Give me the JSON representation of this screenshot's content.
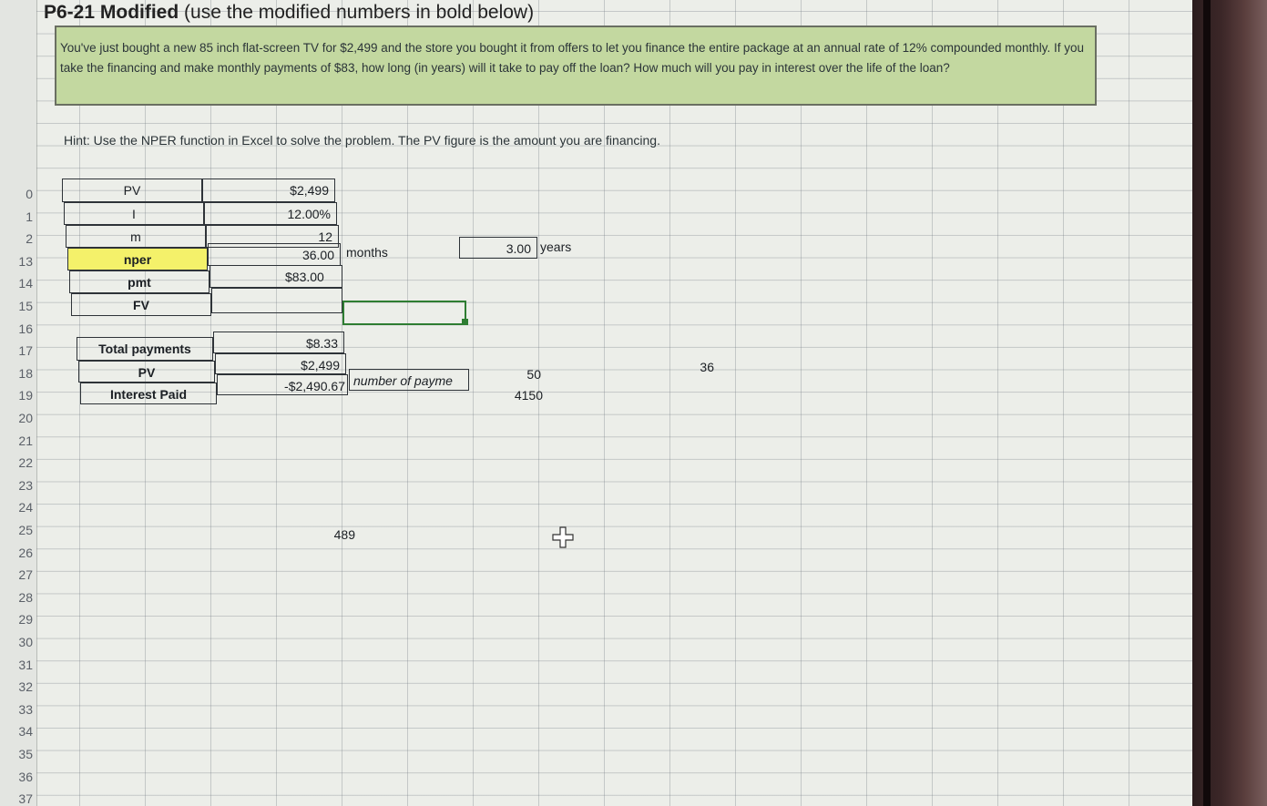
{
  "title": {
    "main": "P6-21 Modified",
    "sub": "(use the modified numbers in bold below)"
  },
  "problem_text": "You've just bought a new 85 inch flat-screen TV for $2,499 and the store you bought it from offers to let you finance the entire package at an annual rate of 12% compounded monthly. If you take the financing and make monthly payments of $83, how long (in years) will it take to pay off the loan? How much will you pay in interest over the life of the loan?",
  "hint": "Hint:  Use the NPER function in Excel to solve the problem.  The PV figure is the amount you are financing.",
  "row_numbers": [
    "0",
    "1",
    "2",
    "13",
    "14",
    "15",
    "16",
    "17",
    "18",
    "19",
    "20",
    "21",
    "22",
    "23",
    "24",
    "25",
    "26",
    "27",
    "28",
    "29",
    "30",
    "31",
    "32",
    "33",
    "34",
    "35",
    "36",
    "37"
  ],
  "inputs": {
    "pv_label": "PV",
    "pv_value": "$2,499",
    "i_label": "I",
    "i_value": "12.00%",
    "m_label": "m",
    "m_value": "12",
    "nper_label": "nper",
    "nper_value": "36.00",
    "nper_unit": "months",
    "pmt_label": "pmt",
    "pmt_value": "$83.00",
    "fv_label": "FV"
  },
  "years": {
    "value": "3.00",
    "unit": "years"
  },
  "summary": {
    "total_payments_label": "Total payments",
    "total_payments_value": "$8.33",
    "pv_label": "PV",
    "pv_value": "$2,499",
    "interest_label": "Interest Paid",
    "interest_value": "-$2,490.67",
    "note": "number of payme"
  },
  "extra": {
    "v50": "50",
    "v4150": "4150",
    "v36": "36",
    "v489": "489"
  },
  "colors": {
    "problem_bg": "#c3d8a0",
    "highlight": "#f4f16a",
    "selection": "#2e7d32"
  }
}
